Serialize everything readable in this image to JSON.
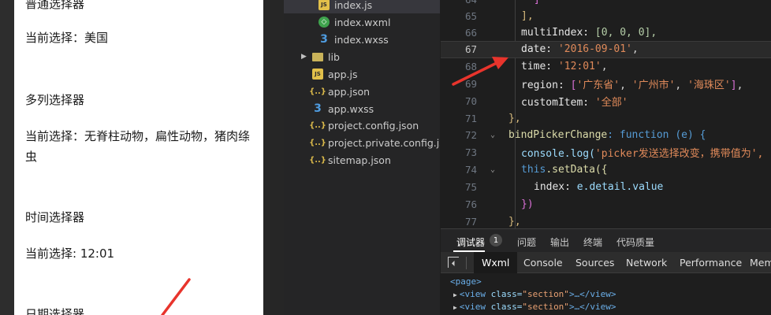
{
  "simulator": {
    "heading_normal_picker": "普通选择器",
    "normal_current": "当前选择：美国",
    "heading_multi_picker": "多列选择器",
    "multi_current": "当前选择：无脊柱动物，扁性动物，猪肉绦虫",
    "heading_time_picker": "时间选择器",
    "time_current": "当前选择: 12:01",
    "heading_date_picker": "日期选择器"
  },
  "file_tree": {
    "items": [
      {
        "label": "index.js",
        "icon": "js-icon",
        "selected": true
      },
      {
        "label": "index.wxml",
        "icon": "wxml-icon"
      },
      {
        "label": "index.wxss",
        "icon": "wxss-icon"
      },
      {
        "label": "lib",
        "icon": "folder-icon"
      },
      {
        "label": "app.js",
        "icon": "js-icon"
      },
      {
        "label": "app.json",
        "icon": "json-icon"
      },
      {
        "label": "app.wxss",
        "icon": "wxss-icon"
      },
      {
        "label": "project.config.json",
        "icon": "json-icon"
      },
      {
        "label": "project.private.config.js...",
        "icon": "json-icon"
      },
      {
        "label": "sitemap.json",
        "icon": "json-icon"
      }
    ]
  },
  "editor": {
    "line_numbers": [
      "64",
      "65",
      "66",
      "67",
      "68",
      "69",
      "70",
      "71",
      "72",
      "73",
      "74",
      "75",
      "76",
      "77"
    ],
    "current_line": "67",
    "lines": {
      "l64": "]",
      "l65": "],",
      "l66_key": "multiIndex: ",
      "l66_val": "[0, 0, 0],",
      "l67_key": "date: ",
      "l67_val": "'2016-09-01'",
      "l67_end": ",",
      "l68_key": "time: ",
      "l68_val": "'12:01'",
      "l68_end": ",",
      "l69_key": "region: ",
      "l69_a": "'广东省'",
      "l69_b": "'广州市'",
      "l69_c": "'海珠区'",
      "l70_key": "customItem: ",
      "l70_val": "'全部'",
      "l71": "},",
      "l72_fn": "bindPickerChange",
      "l72_rest": ": function (e) {",
      "l73_a": "console.log(",
      "l73_b": "'picker发送选择改变，携带值为',",
      "l74_a": "this",
      "l74_b": ".setData({",
      "l75_key": "index: ",
      "l75_val": "e.detail.value",
      "l76": "})",
      "l77": "},"
    }
  },
  "debug_panel": {
    "tabs": [
      "调试器",
      "问题",
      "输出",
      "终端",
      "代码质量"
    ],
    "badge_count": "1"
  },
  "devtools": {
    "tabs": [
      "Wxml",
      "Console",
      "Sources",
      "Network",
      "Performance",
      "Mem"
    ],
    "active_tab": "Wxml"
  },
  "wxml": {
    "page_tag": "<page>",
    "view_open": "<view ",
    "view_attr": "class=",
    "view_val": "\"section\"",
    "view_rest": ">…</view>"
  },
  "colors": {
    "annotation_arrow": "#e8342c"
  }
}
